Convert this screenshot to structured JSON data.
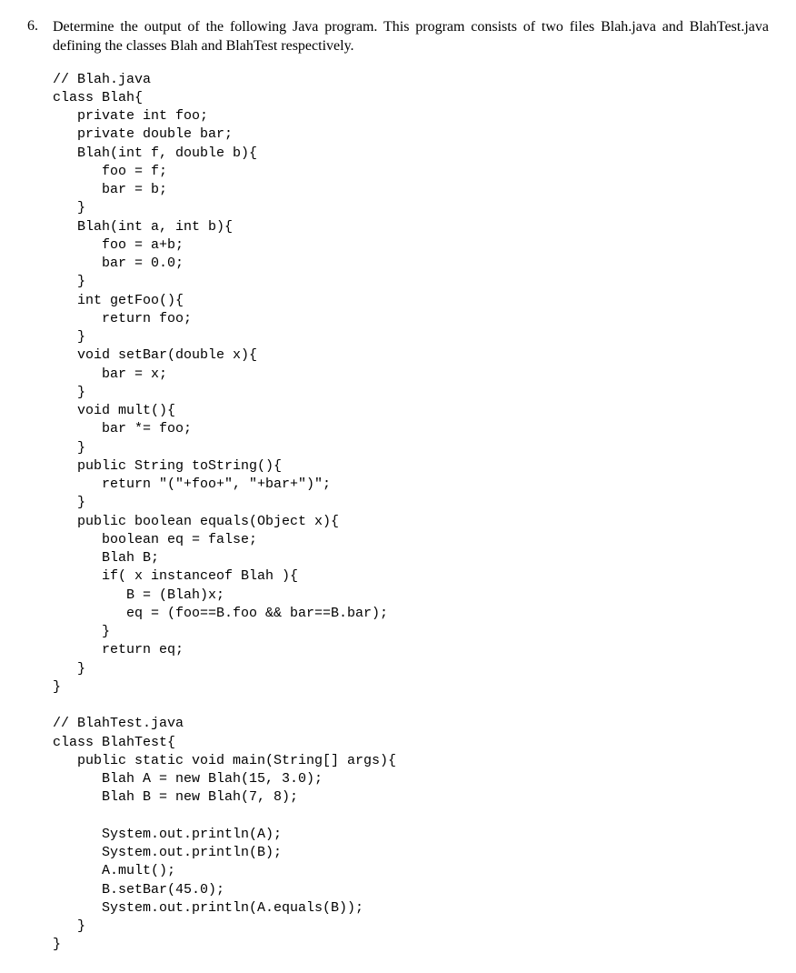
{
  "question": {
    "number": "6.",
    "prompt": "Determine the output of the following Java program. This program consists of two files Blah.java and BlahTest.java defining the classes Blah and BlahTest respectively."
  },
  "code": "// Blah.java\nclass Blah{\n   private int foo;\n   private double bar;\n   Blah(int f, double b){\n      foo = f;\n      bar = b;\n   }\n   Blah(int a, int b){\n      foo = a+b;\n      bar = 0.0;\n   }\n   int getFoo(){\n      return foo;\n   }\n   void setBar(double x){\n      bar = x;\n   }\n   void mult(){\n      bar *= foo;\n   }\n   public String toString(){\n      return \"(\"+foo+\", \"+bar+\")\";\n   }\n   public boolean equals(Object x){\n      boolean eq = false;\n      Blah B;\n      if( x instanceof Blah ){\n         B = (Blah)x;\n         eq = (foo==B.foo && bar==B.bar);\n      }\n      return eq;\n   }\n}\n\n// BlahTest.java\nclass BlahTest{\n   public static void main(String[] args){\n      Blah A = new Blah(15, 3.0);\n      Blah B = new Blah(7, 8);\n\n      System.out.println(A);\n      System.out.println(B);\n      A.mult();\n      B.setBar(45.0);\n      System.out.println(A.equals(B));\n   }\n}"
}
